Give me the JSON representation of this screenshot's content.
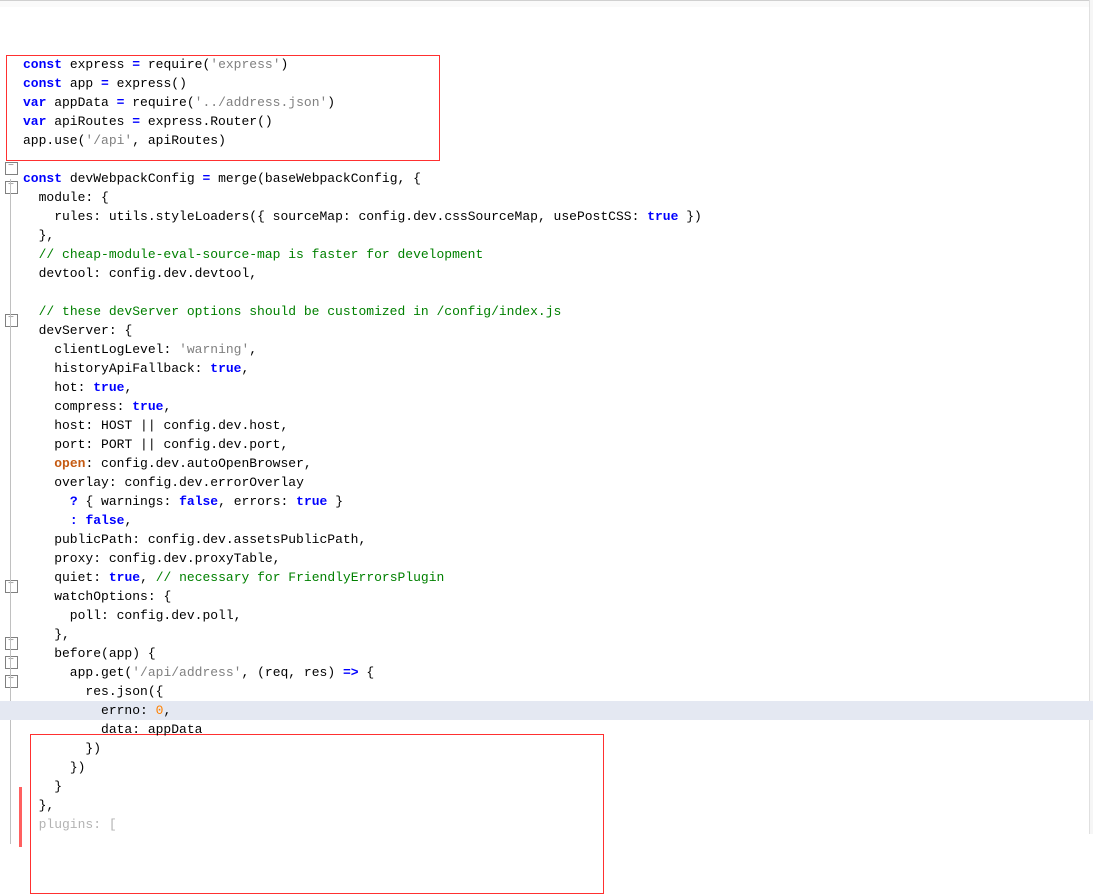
{
  "lines": {
    "blank0": " ",
    "blank1": " ",
    "l1": "const express = require('express')",
    "l2": "const app = express()",
    "l3": "var appData = require('../address.json')",
    "l4": "var apiRoutes = express.Router()",
    "l5": "app.use('/api', apiRoutes)",
    "blank2": " ",
    "l6": "const devWebpackConfig = merge(baseWebpackConfig, {",
    "l7": "  module: {",
    "l8": "    rules: utils.styleLoaders({ sourceMap: config.dev.cssSourceMap, usePostCSS: true })",
    "l9": "  },",
    "l10": "  // cheap-module-eval-source-map is faster for development",
    "l11": "  devtool: config.dev.devtool,",
    "blank3": " ",
    "l12": "  // these devServer options should be customized in /config/index.js",
    "l13": "  devServer: {",
    "l14": "    clientLogLevel: 'warning',",
    "l15": "    historyApiFallback: true,",
    "l16": "    hot: true,",
    "l17": "    compress: true,",
    "l18": "    host: HOST || config.dev.host,",
    "l19": "    port: PORT || config.dev.port,",
    "l20": "    open: config.dev.autoOpenBrowser,",
    "l21": "    overlay: config.dev.errorOverlay",
    "l22": "      ? { warnings: false, errors: true }",
    "l23": "      : false,",
    "l24": "    publicPath: config.dev.assetsPublicPath,",
    "l25": "    proxy: config.dev.proxyTable,",
    "l26": "    quiet: true, // necessary for FriendlyErrorsPlugin",
    "l27": "    watchOptions: {",
    "l28": "      poll: config.dev.poll,",
    "l29": "    },",
    "l30": "    before(app) {",
    "l31": "      app.get('/api/address', (req, res) => {",
    "l32": "        res.json({",
    "l33": "          errno: 0,",
    "l34": "          data: appData",
    "l35": "        })",
    "l36": "      })",
    "l37": "    }",
    "l38": "  },",
    "l39": "  plugins: ["
  },
  "foldMarks": {
    "minus": "−",
    "plus": "+"
  }
}
